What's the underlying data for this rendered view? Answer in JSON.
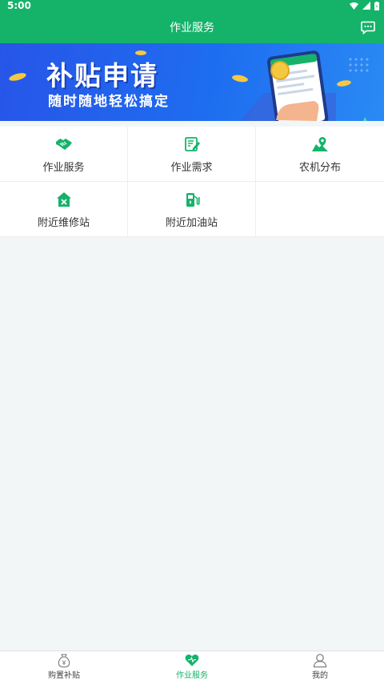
{
  "status": {
    "time": "5:00"
  },
  "header": {
    "title": "作业服务",
    "message_icon": "message-icon"
  },
  "banner": {
    "title": "补贴申请",
    "subtitle": "随时随地轻松搞定"
  },
  "services": [
    {
      "label": "作业服务",
      "icon": "handshake-icon"
    },
    {
      "label": "作业需求",
      "icon": "edit-note-icon"
    },
    {
      "label": "农机分布",
      "icon": "map-pin-icon"
    },
    {
      "label": "附近维修站",
      "icon": "repair-house-icon"
    },
    {
      "label": "附近加油站",
      "icon": "fuel-pump-icon"
    }
  ],
  "tabbar": [
    {
      "label": "购置补贴",
      "icon": "money-bag-icon",
      "active": false
    },
    {
      "label": "作业服务",
      "icon": "heart-icon",
      "active": true
    },
    {
      "label": "我的",
      "icon": "user-icon",
      "active": false
    }
  ],
  "colors": {
    "primary": "#15b36a",
    "banner": "#1e6df0",
    "background": "#f2f6f7"
  }
}
